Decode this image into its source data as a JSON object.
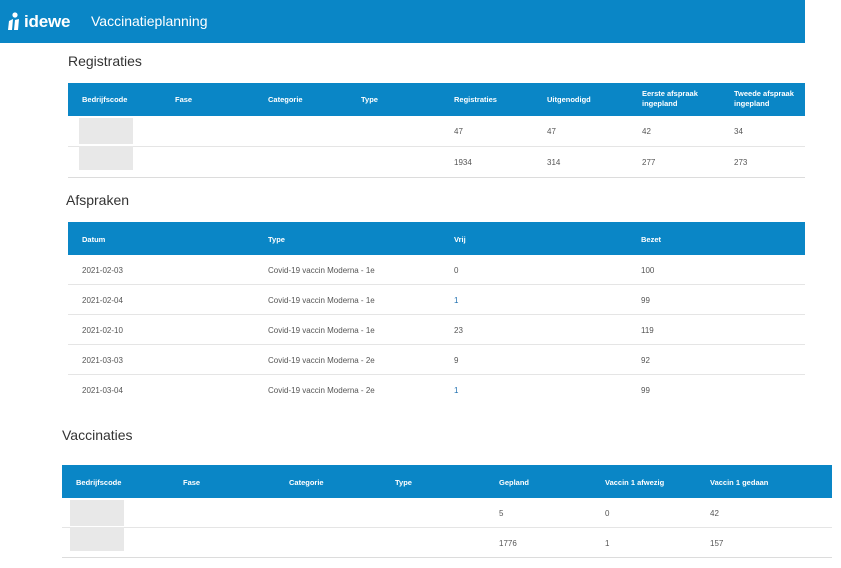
{
  "header": {
    "logo_text": "idewe",
    "app_title": "Vaccinatieplanning"
  },
  "registraties": {
    "title": "Registraties",
    "columns": [
      "Bedrijfscode",
      "Fase",
      "Categorie",
      "Type",
      "Registraties",
      "Uitgenodigd",
      "Eerste afspraak ingepland",
      "Tweede afspraak ingepland"
    ],
    "rows": [
      {
        "registraties": "47",
        "uitgenodigd": "47",
        "eerste": "42",
        "tweede": "34"
      },
      {
        "registraties": "1934",
        "uitgenodigd": "314",
        "eerste": "277",
        "tweede": "273"
      }
    ]
  },
  "afspraken": {
    "title": "Afspraken",
    "columns": [
      "Datum",
      "Type",
      "Vrij",
      "Bezet"
    ],
    "rows": [
      {
        "datum": "2021-02-03",
        "type": "Covid-19 vaccin Moderna - 1e",
        "vrij": "0",
        "bezet": "100"
      },
      {
        "datum": "2021-02-04",
        "type": "Covid-19 vaccin Moderna - 1e",
        "vrij": "1",
        "bezet": "99"
      },
      {
        "datum": "2021-02-10",
        "type": "Covid-19 vaccin Moderna - 1e",
        "vrij": "23",
        "bezet": "119"
      },
      {
        "datum": "2021-03-03",
        "type": "Covid-19 vaccin Moderna - 2e",
        "vrij": "9",
        "bezet": "92"
      },
      {
        "datum": "2021-03-04",
        "type": "Covid-19 vaccin Moderna - 2e",
        "vrij": "1",
        "bezet": "99"
      }
    ]
  },
  "vaccinaties": {
    "title": "Vaccinaties",
    "columns": [
      "Bedrijfscode",
      "Fase",
      "Categorie",
      "Type",
      "Gepland",
      "Vaccin 1 afwezig",
      "Vaccin 1 gedaan"
    ],
    "rows": [
      {
        "gepland": "5",
        "afwezig": "0",
        "gedaan": "42"
      },
      {
        "gepland": "1776",
        "afwezig": "1",
        "gedaan": "157"
      }
    ]
  },
  "colors": {
    "brand": "#0a86c6",
    "link": "#1e6fb0"
  }
}
